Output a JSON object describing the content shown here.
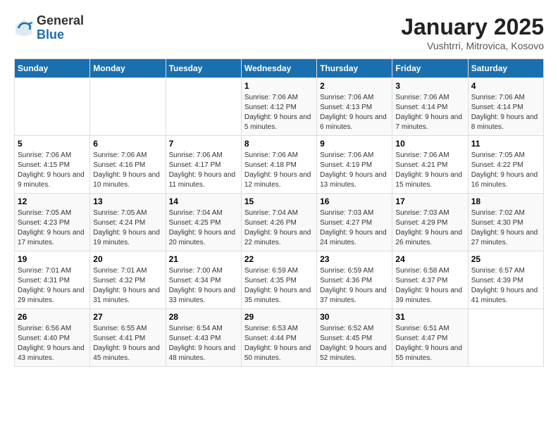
{
  "header": {
    "logo": {
      "line1": "General",
      "line2": "Blue"
    },
    "title": "January 2025",
    "subtitle": "Vushtrri, Mitrovica, Kosovo"
  },
  "calendar": {
    "days_of_week": [
      "Sunday",
      "Monday",
      "Tuesday",
      "Wednesday",
      "Thursday",
      "Friday",
      "Saturday"
    ],
    "weeks": [
      [
        {
          "day": "",
          "info": ""
        },
        {
          "day": "",
          "info": ""
        },
        {
          "day": "",
          "info": ""
        },
        {
          "day": "1",
          "info": "Sunrise: 7:06 AM\nSunset: 4:12 PM\nDaylight: 9 hours\nand 5 minutes."
        },
        {
          "day": "2",
          "info": "Sunrise: 7:06 AM\nSunset: 4:13 PM\nDaylight: 9 hours\nand 6 minutes."
        },
        {
          "day": "3",
          "info": "Sunrise: 7:06 AM\nSunset: 4:14 PM\nDaylight: 9 hours\nand 7 minutes."
        },
        {
          "day": "4",
          "info": "Sunrise: 7:06 AM\nSunset: 4:14 PM\nDaylight: 9 hours\nand 8 minutes."
        }
      ],
      [
        {
          "day": "5",
          "info": "Sunrise: 7:06 AM\nSunset: 4:15 PM\nDaylight: 9 hours\nand 9 minutes."
        },
        {
          "day": "6",
          "info": "Sunrise: 7:06 AM\nSunset: 4:16 PM\nDaylight: 9 hours\nand 10 minutes."
        },
        {
          "day": "7",
          "info": "Sunrise: 7:06 AM\nSunset: 4:17 PM\nDaylight: 9 hours\nand 11 minutes."
        },
        {
          "day": "8",
          "info": "Sunrise: 7:06 AM\nSunset: 4:18 PM\nDaylight: 9 hours\nand 12 minutes."
        },
        {
          "day": "9",
          "info": "Sunrise: 7:06 AM\nSunset: 4:19 PM\nDaylight: 9 hours\nand 13 minutes."
        },
        {
          "day": "10",
          "info": "Sunrise: 7:06 AM\nSunset: 4:21 PM\nDaylight: 9 hours\nand 15 minutes."
        },
        {
          "day": "11",
          "info": "Sunrise: 7:05 AM\nSunset: 4:22 PM\nDaylight: 9 hours\nand 16 minutes."
        }
      ],
      [
        {
          "day": "12",
          "info": "Sunrise: 7:05 AM\nSunset: 4:23 PM\nDaylight: 9 hours\nand 17 minutes."
        },
        {
          "day": "13",
          "info": "Sunrise: 7:05 AM\nSunset: 4:24 PM\nDaylight: 9 hours\nand 19 minutes."
        },
        {
          "day": "14",
          "info": "Sunrise: 7:04 AM\nSunset: 4:25 PM\nDaylight: 9 hours\nand 20 minutes."
        },
        {
          "day": "15",
          "info": "Sunrise: 7:04 AM\nSunset: 4:26 PM\nDaylight: 9 hours\nand 22 minutes."
        },
        {
          "day": "16",
          "info": "Sunrise: 7:03 AM\nSunset: 4:27 PM\nDaylight: 9 hours\nand 24 minutes."
        },
        {
          "day": "17",
          "info": "Sunrise: 7:03 AM\nSunset: 4:29 PM\nDaylight: 9 hours\nand 26 minutes."
        },
        {
          "day": "18",
          "info": "Sunrise: 7:02 AM\nSunset: 4:30 PM\nDaylight: 9 hours\nand 27 minutes."
        }
      ],
      [
        {
          "day": "19",
          "info": "Sunrise: 7:01 AM\nSunset: 4:31 PM\nDaylight: 9 hours\nand 29 minutes."
        },
        {
          "day": "20",
          "info": "Sunrise: 7:01 AM\nSunset: 4:32 PM\nDaylight: 9 hours\nand 31 minutes."
        },
        {
          "day": "21",
          "info": "Sunrise: 7:00 AM\nSunset: 4:34 PM\nDaylight: 9 hours\nand 33 minutes."
        },
        {
          "day": "22",
          "info": "Sunrise: 6:59 AM\nSunset: 4:35 PM\nDaylight: 9 hours\nand 35 minutes."
        },
        {
          "day": "23",
          "info": "Sunrise: 6:59 AM\nSunset: 4:36 PM\nDaylight: 9 hours\nand 37 minutes."
        },
        {
          "day": "24",
          "info": "Sunrise: 6:58 AM\nSunset: 4:37 PM\nDaylight: 9 hours\nand 39 minutes."
        },
        {
          "day": "25",
          "info": "Sunrise: 6:57 AM\nSunset: 4:39 PM\nDaylight: 9 hours\nand 41 minutes."
        }
      ],
      [
        {
          "day": "26",
          "info": "Sunrise: 6:56 AM\nSunset: 4:40 PM\nDaylight: 9 hours\nand 43 minutes."
        },
        {
          "day": "27",
          "info": "Sunrise: 6:55 AM\nSunset: 4:41 PM\nDaylight: 9 hours\nand 45 minutes."
        },
        {
          "day": "28",
          "info": "Sunrise: 6:54 AM\nSunset: 4:43 PM\nDaylight: 9 hours\nand 48 minutes."
        },
        {
          "day": "29",
          "info": "Sunrise: 6:53 AM\nSunset: 4:44 PM\nDaylight: 9 hours\nand 50 minutes."
        },
        {
          "day": "30",
          "info": "Sunrise: 6:52 AM\nSunset: 4:45 PM\nDaylight: 9 hours\nand 52 minutes."
        },
        {
          "day": "31",
          "info": "Sunrise: 6:51 AM\nSunset: 4:47 PM\nDaylight: 9 hours\nand 55 minutes."
        },
        {
          "day": "",
          "info": ""
        }
      ]
    ]
  }
}
